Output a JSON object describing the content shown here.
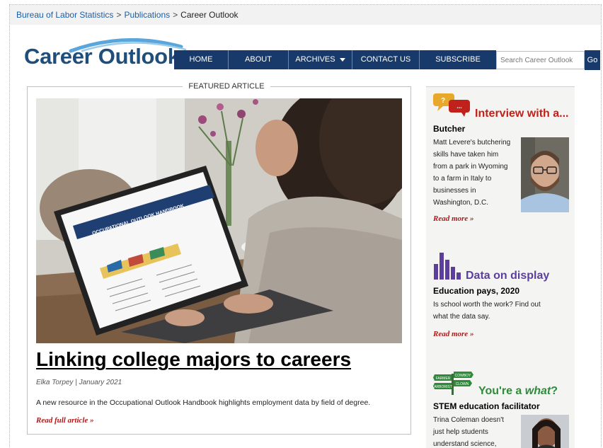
{
  "breadcrumb": {
    "items": [
      "Bureau of Labor Statistics",
      "Publications",
      "Career Outlook"
    ],
    "separator": ">"
  },
  "logo": {
    "text": "Career Outlook",
    "icon": "swoosh-arc-icon"
  },
  "nav": {
    "items": [
      {
        "label": "HOME"
      },
      {
        "label": "ABOUT"
      },
      {
        "label": "ARCHIVES"
      },
      {
        "label": "CONTACT US"
      },
      {
        "label": "SUBSCRIBE"
      }
    ]
  },
  "search": {
    "placeholder": "Search Career Outlook",
    "button_label": "Go"
  },
  "featured": {
    "label": "FEATURED ARTICLE",
    "title": "Linking college majors to careers",
    "byline": "Elka Torpey | January 2021",
    "summary": "A new resource in the Occupational Outlook Handbook highlights employment data by field of degree.",
    "read_full": "Read full article »",
    "screen_heading": "OCCUPATIONAL OUTLOOK HANDBOOK"
  },
  "sidebar": {
    "interview": {
      "heading": "Interview with a...",
      "subheading": "Butcher",
      "text_lines": [
        "Matt Levere's butchering",
        "skills have taken him",
        "from a park in Wyoming",
        "to a farm in Italy to",
        "businesses in",
        "Washington, D.C."
      ],
      "read_more": "Read more »",
      "icon": "speech-bubbles-icon",
      "bubble_texts": [
        "?",
        "..."
      ]
    },
    "data": {
      "heading": "Data on display",
      "subheading": "Education pays, 2020",
      "text_lines": [
        "Is school worth the work? Find out",
        "what the data say."
      ],
      "read_more": "Read more »",
      "icon": "bar-chart-icon"
    },
    "youre_a": {
      "heading_prefix": "You're a ",
      "heading_em": "what",
      "heading_suffix": "?",
      "subheading": "STEM education facilitator",
      "text_lines": [
        "Trina Coleman doesn't",
        "just help students",
        "understand science,"
      ],
      "icon": "signpost-icon",
      "sign_texts": [
        "FARMER",
        "COWBOY",
        "ARBORIST",
        "CLOWN"
      ]
    }
  },
  "colors": {
    "nav_bg": "#183a6b",
    "link_blue": "#1a5ea8",
    "interview_red": "#c0211a",
    "data_purple": "#5b3f9a",
    "youre_green": "#2f8b3a",
    "read_more_red": "#b01919"
  }
}
